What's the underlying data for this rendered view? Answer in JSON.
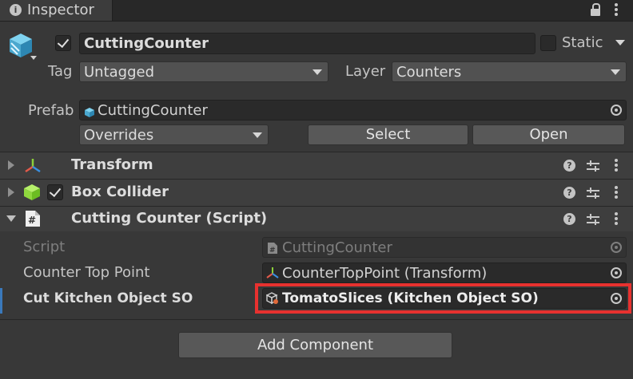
{
  "tab": {
    "info_icon": "i",
    "title": "Inspector"
  },
  "object": {
    "name": "CuttingCounter",
    "static_label": "Static",
    "tag_label": "Tag",
    "tag_value": "Untagged",
    "layer_label": "Layer",
    "layer_value": "Counters"
  },
  "prefab": {
    "label": "Prefab",
    "value": "CuttingCounter",
    "overrides": "Overrides",
    "select_label": "Select",
    "open_label": "Open"
  },
  "components": [
    {
      "name": "Transform",
      "icon": "transform-icon"
    },
    {
      "name": "Box Collider",
      "icon": "box-collider-icon"
    },
    {
      "name": "Cutting Counter (Script)",
      "icon": "script-icon"
    }
  ],
  "script_fields": [
    {
      "label": "Script",
      "value": "CuttingCounter"
    },
    {
      "label": "Counter Top Point",
      "value": "CounterTopPoint (Transform)"
    },
    {
      "label": "Cut Kitchen Object SO",
      "value": "TomatoSlices (Kitchen Object SO)"
    }
  ],
  "add_component": "Add Component",
  "colors": {
    "highlight": "#e8312f",
    "accent": "#3a79bb"
  }
}
